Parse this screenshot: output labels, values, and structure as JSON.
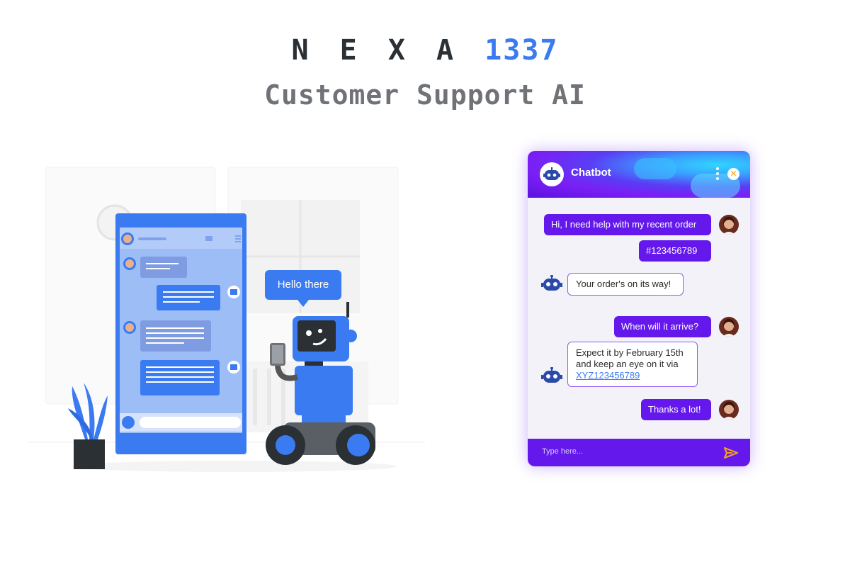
{
  "header": {
    "brand_name": "N E X A",
    "brand_number": "1337",
    "subtitle": "Customer Support AI"
  },
  "illustration": {
    "speech_bubble": "Hello there"
  },
  "chat_widget": {
    "title": "Chatbot",
    "close_symbol": "✕",
    "input_placeholder": "Type here...",
    "icons": {
      "bot_avatar": "robot-icon",
      "menu": "kebab-menu-icon",
      "close": "close-icon",
      "send": "send-icon"
    },
    "messages": [
      {
        "sender": "user",
        "text": "Hi, I need help with my recent order"
      },
      {
        "sender": "user",
        "text": "#123456789"
      },
      {
        "sender": "bot",
        "text": "Your order's on its way!"
      },
      {
        "sender": "user",
        "text": "When will it arrive?"
      },
      {
        "sender": "bot",
        "line1": "Expect it by February 15th",
        "line2": "and keep an eye on it via",
        "link": "XYZ123456789"
      },
      {
        "sender": "user",
        "text": "Thanks a lot!"
      }
    ]
  },
  "colors": {
    "brand_accent": "#3a7bf2",
    "widget_purple": "#6418ec",
    "close_orange": "#f0a020"
  }
}
